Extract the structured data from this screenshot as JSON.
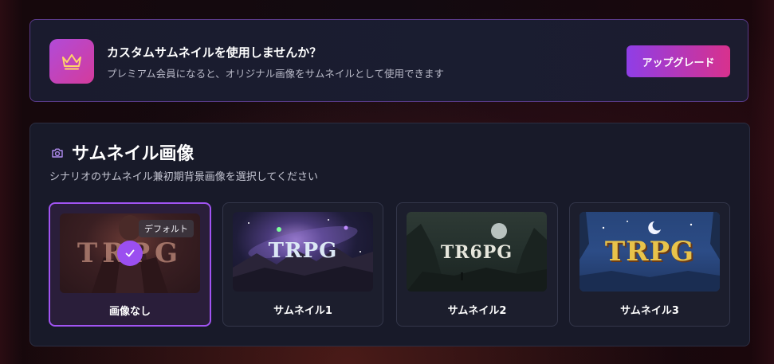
{
  "banner": {
    "icon": "crown-icon",
    "title": "カスタムサムネイルを使用しませんか？",
    "description": "プレミアム会員になると、オリジナル画像をサムネイルとして使用できます",
    "upgrade_label": "アップグレード",
    "accent_gradient": [
      "#8f3ee6",
      "#d8318d"
    ]
  },
  "thumbnail_section": {
    "icon": "camera-icon",
    "title": "サムネイル画像",
    "description": "シナリオのサムネイル兼初期背景画像を選択してください",
    "default_badge": "デフォルト",
    "selected_index": 0,
    "options": [
      {
        "label": "画像なし",
        "thumb_text": "TRPG",
        "selected": true,
        "is_default": true
      },
      {
        "label": "サムネイル1",
        "thumb_text": "TRPG",
        "selected": false
      },
      {
        "label": "サムネイル2",
        "thumb_text": "TR6PG",
        "selected": false
      },
      {
        "label": "サムネイル3",
        "thumb_text": "TRPG",
        "selected": false
      }
    ],
    "selected_border_color": "#a154f2"
  }
}
